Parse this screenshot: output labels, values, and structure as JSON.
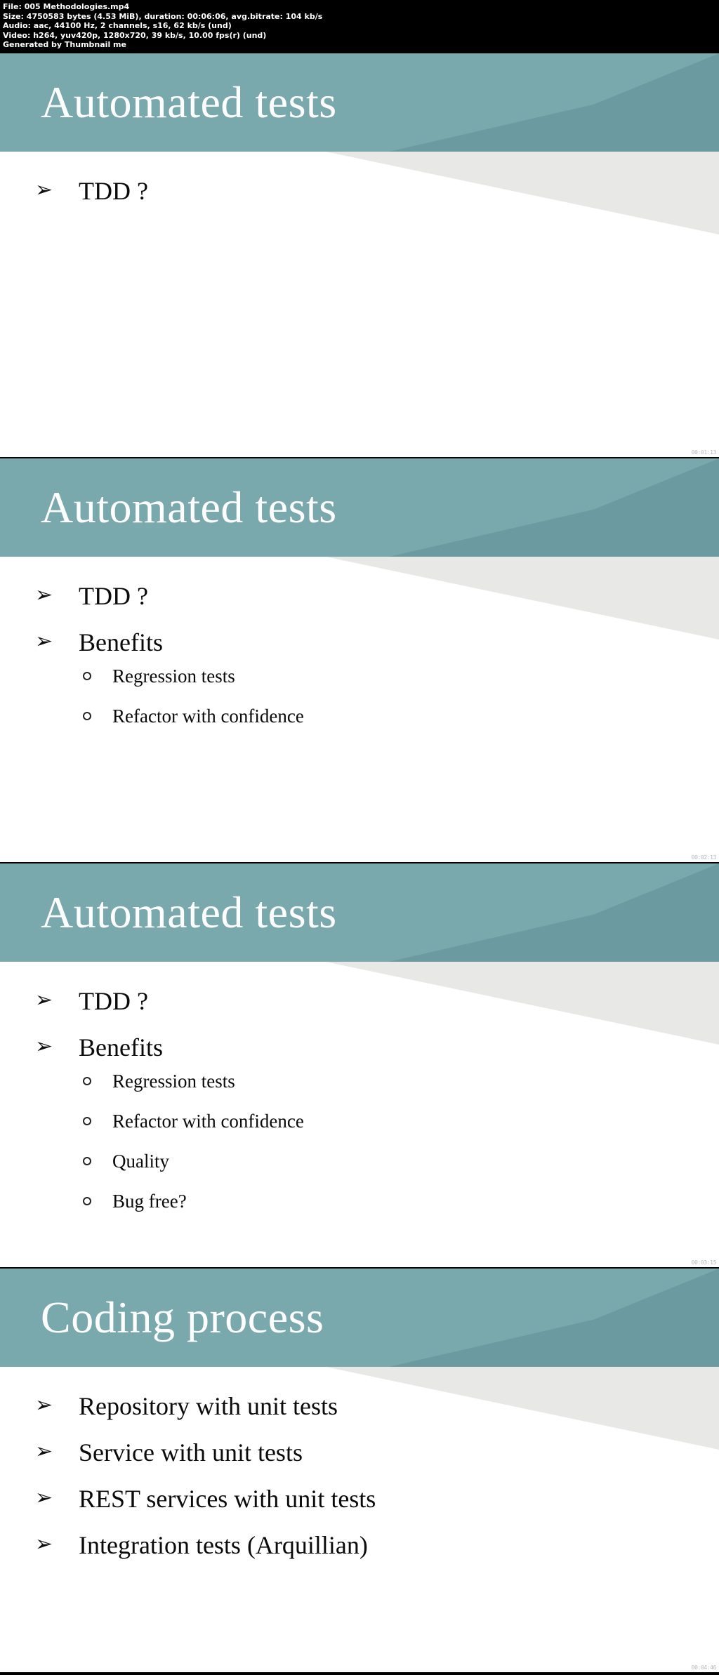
{
  "meta": {
    "file_line": "File: 005 Methodologies.mp4",
    "size_line": "Size: 4750583 bytes (4.53 MiB), duration: 00:06:06, avg.bitrate: 104 kb/s",
    "audio_line": "Audio: aac, 44100 Hz, 2 channels, s16, 62 kb/s (und)",
    "video_line": "Video: h264, yuv420p, 1280x720, 39 kb/s, 10.00 fps(r) (und)",
    "generator_line": "Generated by Thumbnail me"
  },
  "colors": {
    "header_band": "#7aa9ad",
    "header_wedge": "#6b9ba0",
    "body_wedge": "#e8e8e6",
    "title_text": "#fdfdfd",
    "body_text": "#0b0b0b",
    "meta_bg": "#000000",
    "meta_text": "#ffffff",
    "timestamp_text": "#b9b9b9"
  },
  "icons": {
    "arrow_bullet": "➢",
    "circle_bullet": "circle-outline-bullet-icon"
  },
  "slides": [
    {
      "title": "Automated tests",
      "timestamp": "00:01:13",
      "bullets": [
        {
          "text": "TDD ?",
          "sub": []
        }
      ]
    },
    {
      "title": "Automated tests",
      "timestamp": "00:02:13",
      "bullets": [
        {
          "text": "TDD ?",
          "sub": []
        },
        {
          "text": "Benefits",
          "sub": [
            "Regression tests",
            "Refactor with confidence"
          ]
        }
      ]
    },
    {
      "title": "Automated tests",
      "timestamp": "00:03:15",
      "bullets": [
        {
          "text": "TDD ?",
          "sub": []
        },
        {
          "text": "Benefits",
          "sub": [
            "Regression tests",
            "Refactor with confidence",
            "Quality",
            "Bug free?"
          ]
        }
      ]
    },
    {
      "title": "Coding process",
      "timestamp": "00:04:46",
      "bullets": [
        {
          "text": "Repository with unit tests",
          "sub": []
        },
        {
          "text": "Service with unit tests",
          "sub": []
        },
        {
          "text": "REST services with unit tests",
          "sub": []
        },
        {
          "text": "Integration tests (Arquillian)",
          "sub": []
        }
      ]
    }
  ]
}
